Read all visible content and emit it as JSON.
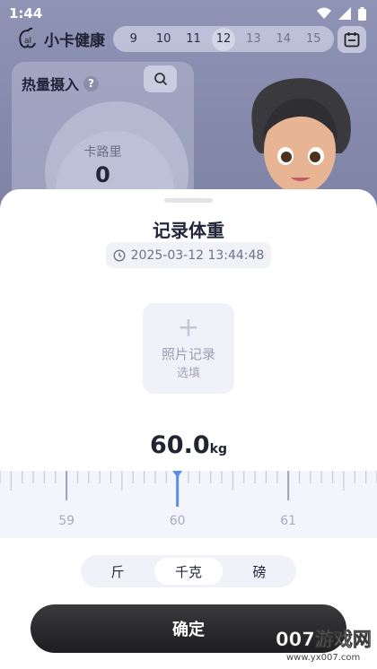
{
  "status_bar": {
    "time": "1:44"
  },
  "app": {
    "name": "小卡健康",
    "dates": [
      "9",
      "10",
      "11",
      "12",
      "13",
      "14",
      "15"
    ],
    "selected_date": "12",
    "calorie_card": {
      "title": "热量摄入",
      "label": "卡路里",
      "value": "0"
    }
  },
  "sheet": {
    "title": "记录体重",
    "timestamp": "2025-03-12 13:44:48",
    "photo": {
      "label": "照片记录",
      "sub": "选填"
    },
    "weight": {
      "value": "60.0",
      "unit": "kg"
    },
    "ruler": {
      "labels": [
        "59",
        "60",
        "61"
      ],
      "current": 60.0,
      "min": 58.4,
      "max": 61.8
    },
    "units": [
      "斤",
      "千克",
      "磅"
    ],
    "active_unit": "千克",
    "confirm_label": "确定"
  },
  "watermark": {
    "text": "007游戏网",
    "url": "www.yx007.com"
  },
  "colors": {
    "accent": "#5b8def",
    "sheet_bg": "#ffffff",
    "confirm_bg": "#1e1e20"
  }
}
